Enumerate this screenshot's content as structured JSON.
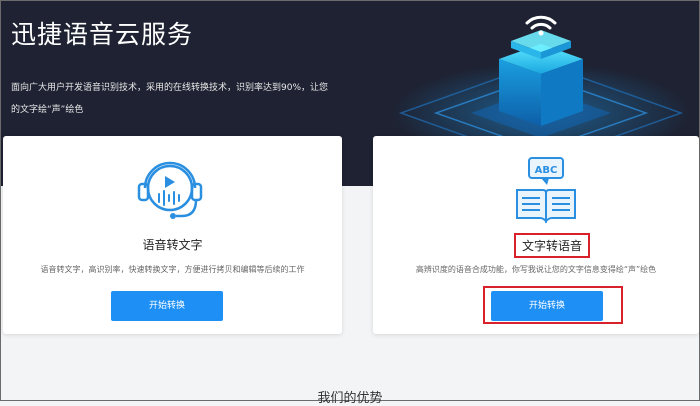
{
  "hero": {
    "title": "迅捷语音云服务",
    "description": "面向广大用户开发语音识别技术，采用的在线转换技术，识别率达到90%，让您的文字绘“声”绘色"
  },
  "cards": [
    {
      "title": "语音转文字",
      "description": "语音转文字，高识别率，快速转换文字，方便进行拷贝和编辑等后续的工作",
      "button_label": "开始转换",
      "icon": "headset-icon"
    },
    {
      "title": "文字转语音",
      "description": "高辨识度的语音合成功能，你写我说让您的文字信息变得绘“声”绘色",
      "button_label": "开始转换",
      "icon": "book-abc-icon",
      "icon_text": "ABC"
    }
  ],
  "section": {
    "title": "我们的优势"
  },
  "colors": {
    "hero_bg": "#1e2232",
    "accent": "#1e90f5",
    "highlight_border": "#d9212b"
  }
}
